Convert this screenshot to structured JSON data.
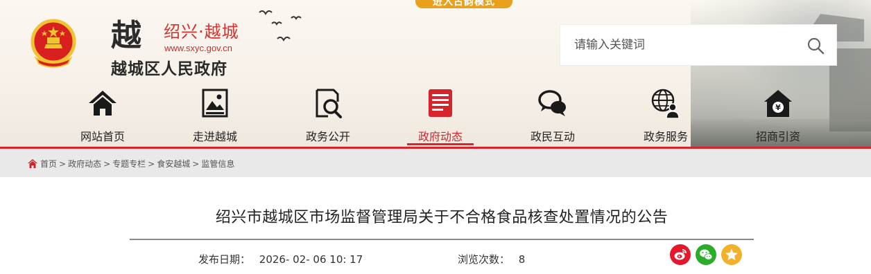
{
  "top_banner": {
    "label": "进入古韵模式"
  },
  "site": {
    "logo_char": "越",
    "brand": "绍兴·越城",
    "url": "www.sxyc.gov.cn",
    "name": "越城区人民政府"
  },
  "search": {
    "placeholder": "请输入关键词"
  },
  "nav": {
    "items": [
      {
        "label": "网站首页",
        "icon": "home-icon"
      },
      {
        "label": "走进越城",
        "icon": "picture-icon"
      },
      {
        "label": "政务公开",
        "icon": "document-search-icon"
      },
      {
        "label": "政府动态",
        "icon": "news-icon",
        "active": true
      },
      {
        "label": "政民互动",
        "icon": "chat-bubbles-icon"
      },
      {
        "label": "政务服务",
        "icon": "globe-user-icon"
      },
      {
        "label": "招商引资",
        "icon": "yuan-house-icon"
      }
    ]
  },
  "breadcrumb": {
    "items": [
      "首页",
      "政府动态",
      "专题专栏",
      "食安越城",
      "监管信息"
    ],
    "separator": ">"
  },
  "article": {
    "title": "绍兴市越城区市场监督管理局关于不合格食品核查处置情况的公告",
    "date_label": "发布日期：",
    "date_value": "2026- 02- 06 10: 17",
    "views_label": "浏览次数：",
    "views_value": "8"
  },
  "share": {
    "items": [
      {
        "name": "weibo-share-icon",
        "color": "#e6162d"
      },
      {
        "name": "wechat-share-icon",
        "color": "#2bad2b"
      },
      {
        "name": "favorite-star-icon",
        "color": "#f3b02a"
      }
    ]
  },
  "colors": {
    "accent_red": "#d7232b",
    "banner_orange": "#e9a01b",
    "breadcrumb_bg": "#e9e9e9"
  }
}
